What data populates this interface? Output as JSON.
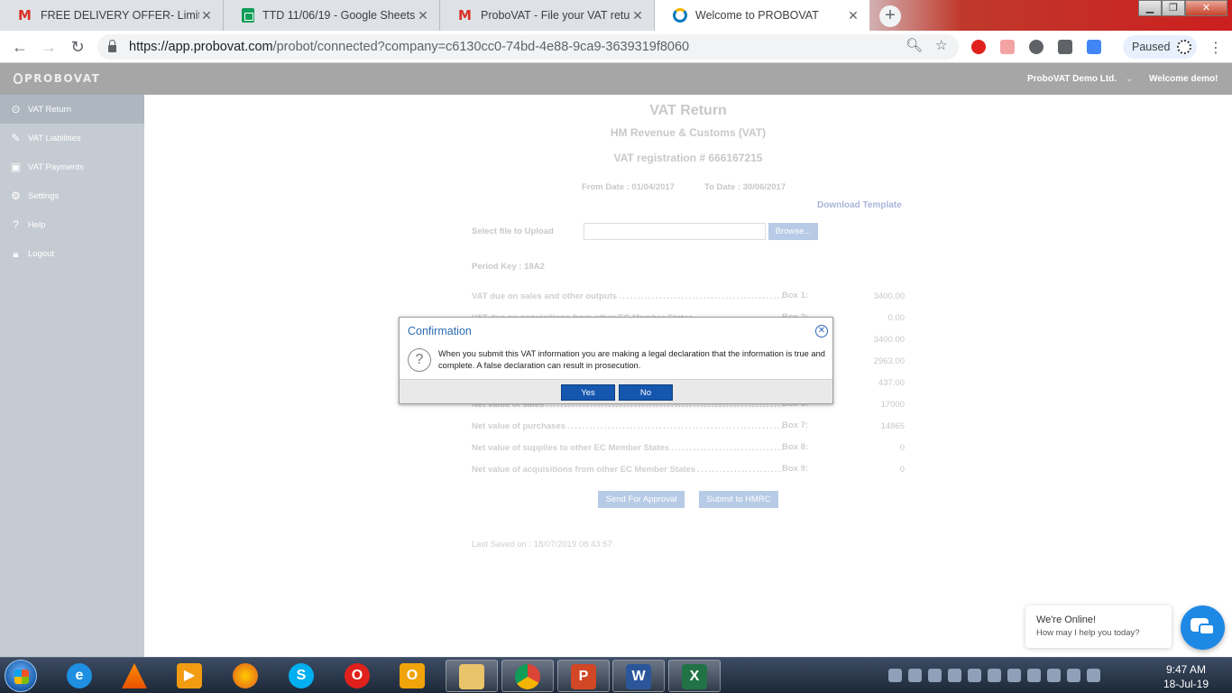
{
  "browser": {
    "tabs": [
      {
        "title": "FREE DELIVERY OFFER- Limited T",
        "favicon": "gmail-icon",
        "active": false
      },
      {
        "title": "TTD 11/06/19 - Google Sheets",
        "favicon": "sheets-icon",
        "active": false
      },
      {
        "title": "ProboVAT - File your VAT return",
        "favicon": "gmail-icon",
        "active": false
      },
      {
        "title": "Welcome to PROBOVAT",
        "favicon": "probovat-icon",
        "active": true
      }
    ],
    "url_host": "https://app.probovat.com",
    "url_path": "/probot/connected?company=c6130cc0-74bd-4e88-9ca9-3639319f8060",
    "profile_status": "Paused"
  },
  "app": {
    "logo_text": "PROBOVAT",
    "company_name": "ProboVAT Demo Ltd.",
    "welcome_text": "Welcome demo!"
  },
  "sidebar": {
    "items": [
      {
        "label": "VAT Return",
        "icon": "return-icon",
        "active": true
      },
      {
        "label": "VAT Liabilities",
        "icon": "liabilities-icon",
        "active": false
      },
      {
        "label": "VAT Payments",
        "icon": "payments-icon",
        "active": false
      },
      {
        "label": "Settings",
        "icon": "gear-icon",
        "active": false
      },
      {
        "label": "Help",
        "icon": "help-icon",
        "active": false
      },
      {
        "label": "Logout",
        "icon": "lock-icon",
        "active": false
      }
    ]
  },
  "form": {
    "title": "VAT Return",
    "subtitle": "HM Revenue & Customs (VAT)",
    "registration": "VAT registration # 666167215",
    "from_date": "From Date : 01/04/2017",
    "to_date": "To Date : 30/06/2017",
    "download_template": "Download Template",
    "select_file_label": "Select file to Upload",
    "browse_label": "Browse...",
    "period_key": "Period Key : 18A2",
    "rows": [
      {
        "label": "VAT due on sales and other outputs",
        "box": "Box 1:",
        "value": "3400.00"
      },
      {
        "label": "VAT due on acquisitions from other EC Member States",
        "box": "Box 2:",
        "value": "0.00"
      },
      {
        "label": "",
        "box": "",
        "value": "3400.00"
      },
      {
        "label": "",
        "box": "",
        "value": "2963.00"
      },
      {
        "label": "",
        "box": "",
        "value": "437.00"
      },
      {
        "label": "Net value of sales",
        "box": "Box 6:",
        "value": "17000"
      },
      {
        "label": "Net value of purchases",
        "box": "Box 7:",
        "value": "14865"
      },
      {
        "label": "Net value of supplies to other EC Member States",
        "box": "Box 8:",
        "value": "0"
      },
      {
        "label": "Net value of acquisitions from other EC Member States",
        "box": "Box 9:",
        "value": "0"
      }
    ],
    "send_for_approval": "Send For Approval",
    "submit_to_hmrc": "Submit to HMRC",
    "last_saved": "Last Saved on : 18/07/2019 08:43:57"
  },
  "dialog": {
    "title": "Confirmation",
    "message": "When you submit this VAT information you are making a legal declaration that the information is true and complete. A false declaration can result in prosecution.",
    "yes_label": "Yes",
    "no_label": "No"
  },
  "chat": {
    "status": "We're Online!",
    "prompt": "How may I help you today?"
  },
  "taskbar": {
    "apps": [
      "internet-explorer-icon",
      "vlc-icon",
      "media-player-icon",
      "firefox-icon",
      "skype-icon",
      "opera-icon",
      "outlook-icon",
      "file-explorer-icon",
      "chrome-icon",
      "powerpoint-icon",
      "word-icon",
      "excel-icon"
    ],
    "time": "9:47 AM",
    "date": "18-Jul-19"
  },
  "colors": {
    "dialog_title": "#2b6cb3",
    "dialog_button": "#1557ae",
    "sidebar_bg": "#c5cbd2",
    "header_bg": "#a6a6a6",
    "chat_button": "#1e88e5"
  }
}
